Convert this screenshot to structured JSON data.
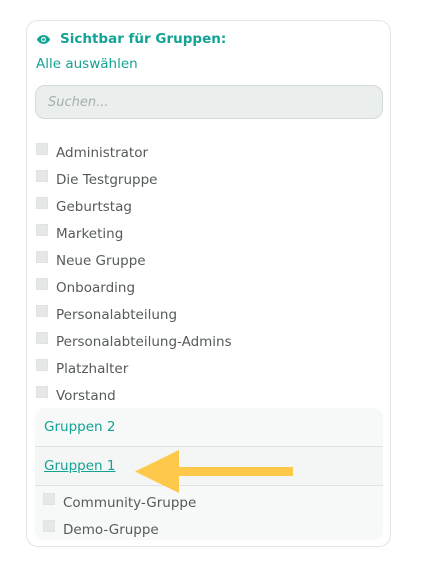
{
  "section": {
    "title": "Sichtbar für Gruppen:",
    "icon": "eye-icon",
    "accent_color": "#13a394"
  },
  "select_all_label": "Alle auswählen",
  "search": {
    "placeholder": "Suchen...",
    "value": ""
  },
  "groups": [
    {
      "label": "Administrator",
      "checked": false
    },
    {
      "label": "Die Testgruppe",
      "checked": false
    },
    {
      "label": "Geburtstag",
      "checked": false
    },
    {
      "label": "Marketing",
      "checked": false
    },
    {
      "label": "Neue Gruppe",
      "checked": false
    },
    {
      "label": "Onboarding",
      "checked": false
    },
    {
      "label": "Personalabteilung",
      "checked": false
    },
    {
      "label": "Personalabteilung-Admins",
      "checked": false
    },
    {
      "label": "Platzhalter",
      "checked": false
    },
    {
      "label": "Vorstand",
      "checked": false
    }
  ],
  "categories": [
    {
      "label": "Gruppen 2"
    },
    {
      "label": "Gruppen 1",
      "active": true
    }
  ],
  "subgroups": [
    {
      "label": "Community-Gruppe",
      "checked": false
    },
    {
      "label": "Demo-Gruppe",
      "checked": false
    }
  ],
  "annotation": {
    "icon": "arrow-left-icon",
    "color": "#fec84b"
  }
}
